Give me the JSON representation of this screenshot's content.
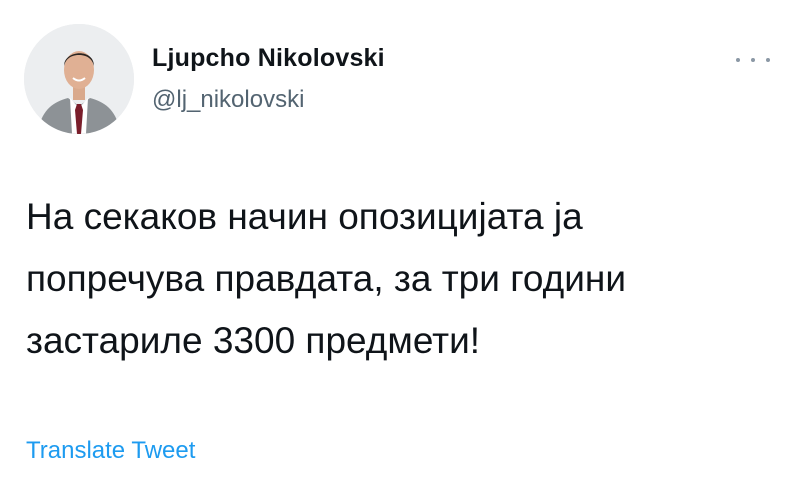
{
  "author": {
    "display_name": "Ljupcho Nikolovski",
    "handle": "@lj_nikolovski"
  },
  "tweet": {
    "text": "На секаков начин опозицијата ја\nпопречува правдата, за три години\nзастариле 3300 предмети!"
  },
  "actions": {
    "more_icon": "more-horizontal-icon",
    "translate_label": "Translate Tweet"
  },
  "colors": {
    "text_primary": "#0f1419",
    "text_secondary": "#536471",
    "link": "#1d9bf0",
    "background": "#ffffff"
  }
}
